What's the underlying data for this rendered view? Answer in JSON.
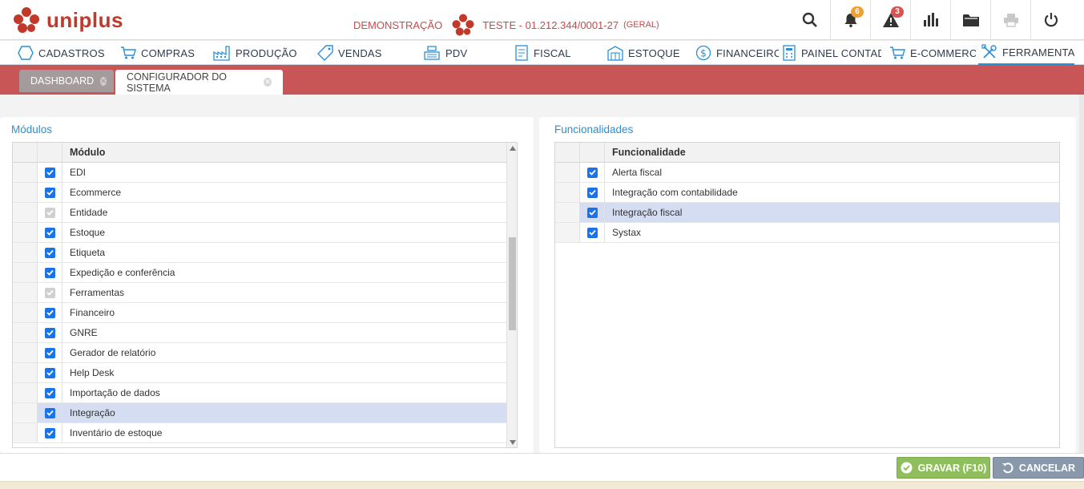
{
  "brand": {
    "logo_text": "uniplus"
  },
  "company": {
    "mode": "DEMONSTRAÇÃO",
    "name": "TESTE - 01.212.344/0001-27",
    "scope": "(GERAL)"
  },
  "header_icons": [
    {
      "icon": "search-icon"
    },
    {
      "icon": "bell-icon",
      "badge": "6"
    },
    {
      "icon": "warning-icon",
      "badge": "3"
    },
    {
      "icon": "bar-chart-icon"
    },
    {
      "icon": "folder-icon"
    },
    {
      "icon": "printer-icon"
    },
    {
      "icon": "power-icon"
    }
  ],
  "menu": {
    "items": [
      {
        "label": "CADASTROS",
        "icon": "hexagon-icon"
      },
      {
        "label": "COMPRAS",
        "icon": "cart-icon"
      },
      {
        "label": "PRODUÇÃO",
        "icon": "factory-icon"
      },
      {
        "label": "VENDAS",
        "icon": "tag-icon"
      },
      {
        "label": "PDV",
        "icon": "cash-register-icon"
      },
      {
        "label": "FISCAL",
        "icon": "document-icon"
      },
      {
        "label": "ESTOQUE",
        "icon": "warehouse-icon"
      },
      {
        "label": "FINANCEIRO",
        "icon": "dollar-icon"
      },
      {
        "label": "PAINEL CONTADOR",
        "icon": "accountant-icon"
      },
      {
        "label": "E-COMMERCE",
        "icon": "cart-icon"
      },
      {
        "label": "FERRAMENTAS",
        "icon": "tools-icon",
        "active": true
      }
    ]
  },
  "tabs": [
    {
      "label": "DASHBOARD",
      "active": false
    },
    {
      "label": "CONFIGURADOR DO SISTEMA",
      "active": true
    }
  ],
  "modules": {
    "title": "Módulos",
    "column": "Módulo",
    "rows": [
      {
        "label": "EDI",
        "checked": true,
        "disabled": false
      },
      {
        "label": "Ecommerce",
        "checked": true,
        "disabled": false
      },
      {
        "label": "Entidade",
        "checked": true,
        "disabled": true
      },
      {
        "label": "Estoque",
        "checked": true,
        "disabled": false
      },
      {
        "label": "Etiqueta",
        "checked": true,
        "disabled": false
      },
      {
        "label": "Expedição e conferência",
        "checked": true,
        "disabled": false
      },
      {
        "label": "Ferramentas",
        "checked": true,
        "disabled": true
      },
      {
        "label": "Financeiro",
        "checked": true,
        "disabled": false
      },
      {
        "label": "GNRE",
        "checked": true,
        "disabled": false
      },
      {
        "label": "Gerador de relatório",
        "checked": true,
        "disabled": false
      },
      {
        "label": "Help Desk",
        "checked": true,
        "disabled": false
      },
      {
        "label": "Importação de dados",
        "checked": true,
        "disabled": false
      },
      {
        "label": "Integração",
        "checked": true,
        "disabled": false,
        "selected": true
      },
      {
        "label": "Inventário de estoque",
        "checked": true,
        "disabled": false
      }
    ]
  },
  "features": {
    "title": "Funcionalidades",
    "column": "Funcionalidade",
    "rows": [
      {
        "label": "Alerta fiscal",
        "checked": true
      },
      {
        "label": "Integração com contabilidade",
        "checked": true
      },
      {
        "label": "Integração fiscal",
        "checked": true,
        "selected": true
      },
      {
        "label": "Systax",
        "checked": true
      }
    ]
  },
  "footer": {
    "save_label": "GRAVAR (F10)",
    "cancel_label": "CANCELAR"
  },
  "colors": {
    "brand_red": "#c94a4a",
    "accent_blue": "#2a8fd6",
    "save_green": "#8fbf5c",
    "cancel_gray": "#8a98ab"
  }
}
